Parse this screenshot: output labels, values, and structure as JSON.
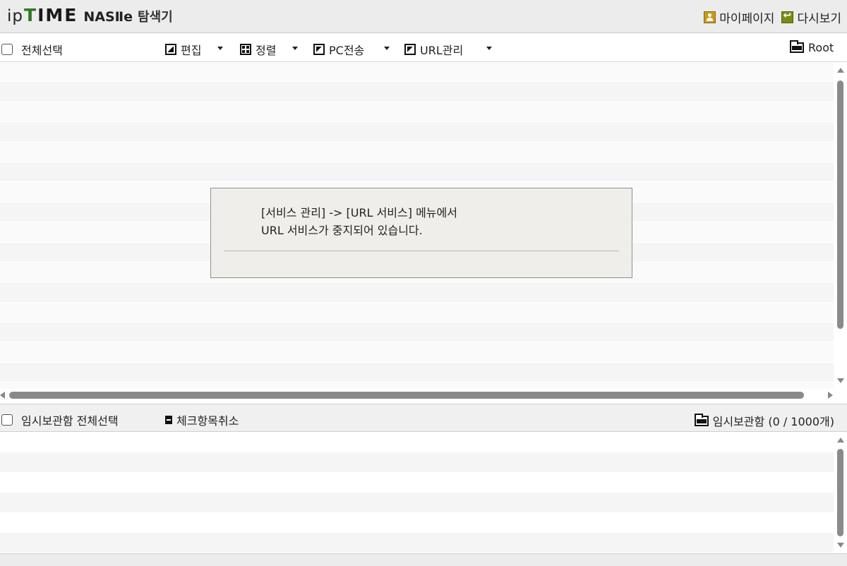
{
  "header": {
    "logo_ip": "ip",
    "logo_time_t": "T",
    "logo_time_i": "I",
    "logo_time_m": "M",
    "logo_time_e": "E",
    "logo_nas": "NASⅡe",
    "logo_sub": "탐색기",
    "mypage_label": "마이페이지",
    "refresh_label": "다시보기"
  },
  "toolbar": {
    "select_all_label": "전체선택",
    "edit_label": "편집",
    "sort_label": "정렬",
    "pc_transfer_label": "PC전송",
    "url_manage_label": "URL관리",
    "root_label": "Root"
  },
  "dialog": {
    "line1": "[서비스 관리] -> [URL 서비스] 메뉴에서",
    "line2": "URL 서비스가 중지되어 있습니다."
  },
  "temp_storage": {
    "select_all_label": "임시보관함 전체선택",
    "uncheck_label": "체크항목취소",
    "count_label": "임시보관함 (0 / 1000개)"
  }
}
